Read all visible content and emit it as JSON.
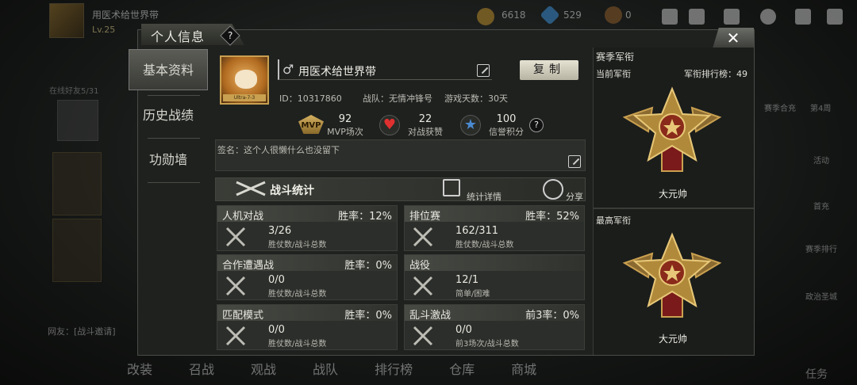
{
  "topbar": {
    "player_name": "用医术给世界带",
    "level": "Lv.25",
    "coins": "6618",
    "diamonds": "529",
    "tickets": "0"
  },
  "dialog": {
    "title": "个人信息",
    "help": "?",
    "close": "✕"
  },
  "nav": {
    "items": [
      "基本资料",
      "历史战绩",
      "功勋墙"
    ]
  },
  "profile": {
    "gender_symbol": "♂",
    "name": "用医术给世界带",
    "copy_label": "复制",
    "id_text": "ID：10317860",
    "team_text": "战队：无情冲锋号",
    "days_text": "游戏天数：30天",
    "avatar_banner": "Ultra-7-3"
  },
  "stats": {
    "mvp_icon_text": "MVP",
    "mvp_value": "92",
    "mvp_label": "MVP场次",
    "likes_value": "22",
    "likes_label": "对战获赞",
    "credit_value": "100",
    "credit_label": "信誉积分",
    "help": "?"
  },
  "signature": {
    "text": "签名：这个人很懒什么也没留下"
  },
  "battle": {
    "section_title": "战斗统计",
    "details_label": "统计详情",
    "share_label": "分享",
    "cards": [
      {
        "name": "人机对战",
        "rate": "胜率：12%",
        "value": "3/26",
        "sub": "胜仗数/战斗总数"
      },
      {
        "name": "排位赛",
        "rate": "胜率：52%",
        "value": "162/311",
        "sub": "胜仗数/战斗总数"
      },
      {
        "name": "合作遭遇战",
        "rate": "胜率：0%",
        "value": "0/0",
        "sub": "胜仗数/战斗总数"
      },
      {
        "name": "战役",
        "rate": "",
        "value": "12/1",
        "sub": "简单/困难"
      },
      {
        "name": "匹配模式",
        "rate": "胜率：0%",
        "value": "0/0",
        "sub": "胜仗数/战斗总数"
      },
      {
        "name": "乱斗激战",
        "rate": "前3率：0%",
        "value": "0/0",
        "sub": "前3场次/战斗总数"
      }
    ]
  },
  "rank": {
    "season_title": "赛季军衔",
    "current_label": "当前军衔",
    "leaderboard_label": "军衔排行榜：49",
    "current_rank": "大元帅",
    "highest_label": "最高军衔",
    "highest_rank": "大元帅"
  },
  "bottom_nav": [
    "改装",
    "召战",
    "观战",
    "战队",
    "排行榜",
    "仓库",
    "商城"
  ],
  "right_bg": [
    "赛季合充",
    "第4周",
    "活动",
    "首充",
    "赛季排行",
    "政治圣城",
    "任务"
  ],
  "left_bg": {
    "online_friends": "在线好友5/31",
    "chat_text": "网友：[战斗邀请]"
  },
  "colors": {
    "panel": "#1f211f",
    "card": "#2c2e2b",
    "gold": "#c9a050",
    "heart": "#e03030",
    "star": "#4a8ad0"
  }
}
